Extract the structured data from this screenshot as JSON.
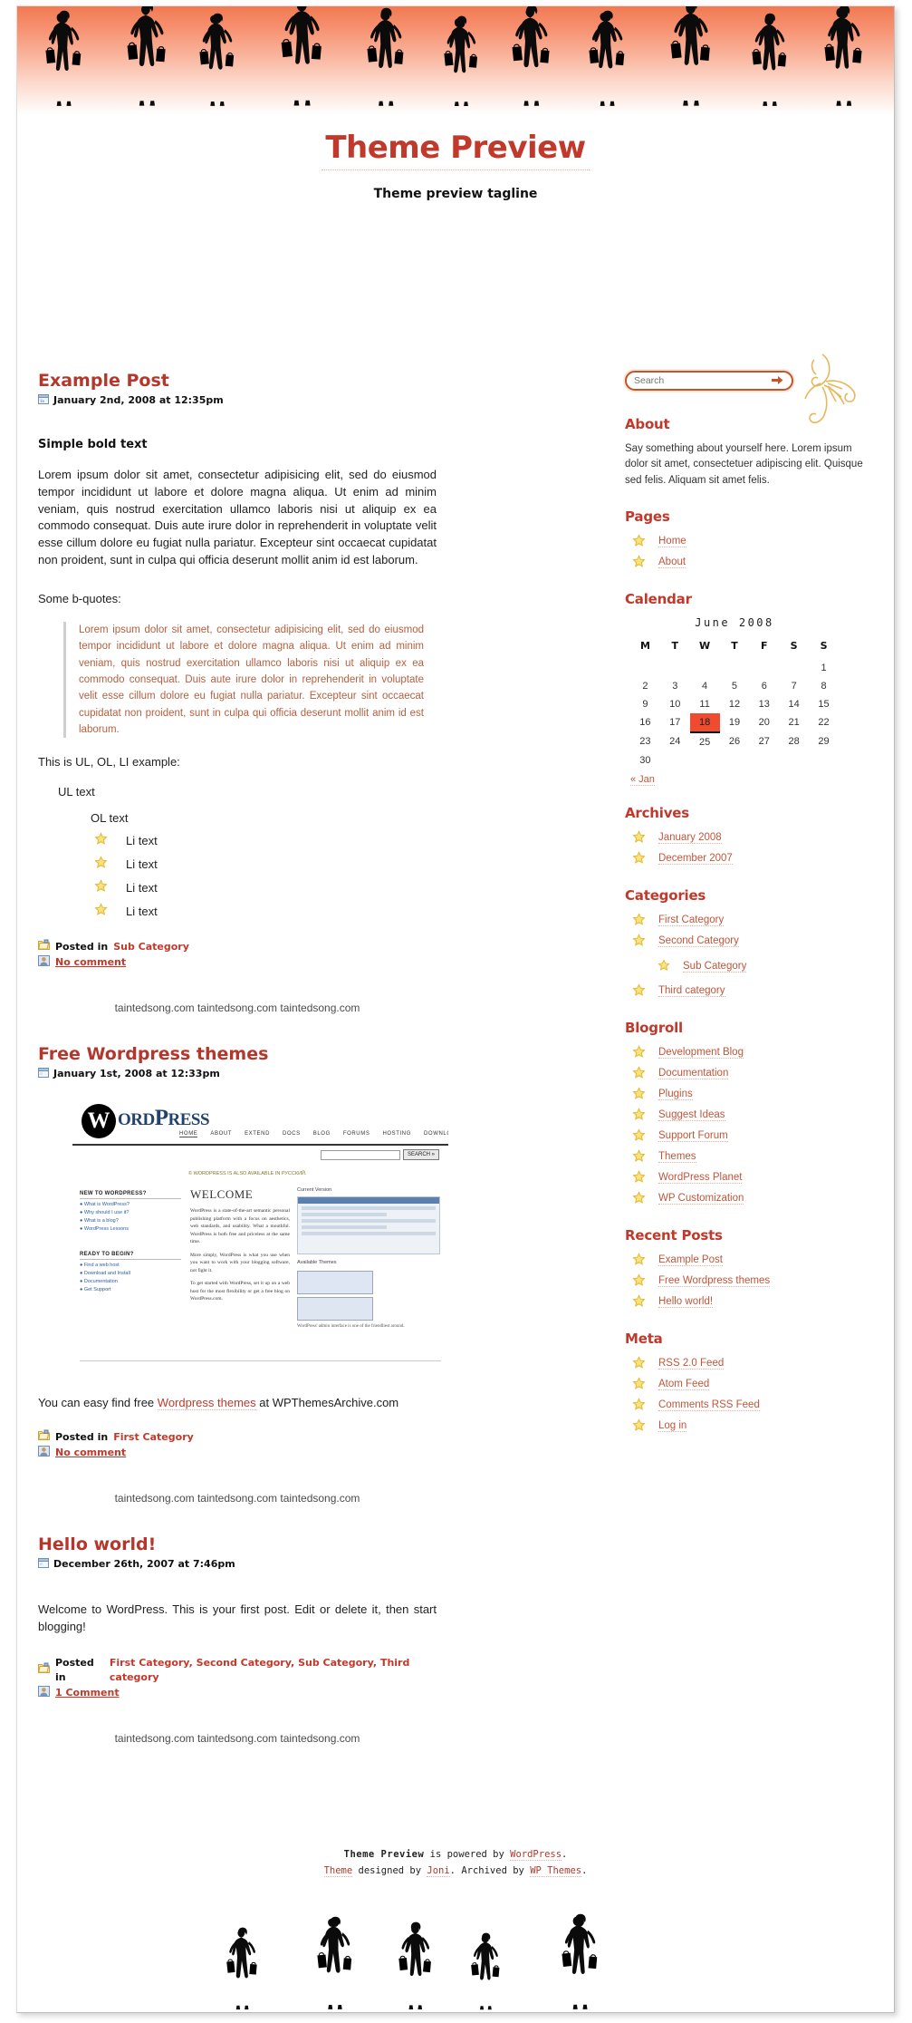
{
  "site": {
    "title": "Theme Preview",
    "tagline": "Theme preview tagline"
  },
  "colors": {
    "accent": "#c0392b",
    "link": "#c0563a",
    "quote": "#b5603f",
    "today_highlight": "#ef4b31",
    "header_gradient_top": "#f07a52"
  },
  "posts": [
    {
      "title": "Example Post",
      "date": "January 2nd, 2008 at 12:35pm",
      "date_icon": "calendar-icon",
      "bold_intro": "Simple bold text",
      "paragraph": "Lorem ipsum dolor sit amet, consectetur adipisicing elit, sed do eiusmod tempor incididunt ut labore et dolore magna aliqua. Ut enim ad minim veniam, quis nostrud exercitation ullamco laboris nisi ut aliquip ex ea commodo consequat. Duis aute irure dolor in reprehenderit in voluptate velit esse cillum dolore eu fugiat nulla pariatur. Excepteur sint occaecat cupidatat non proident, sunt in culpa qui officia deserunt mollit anim id est laborum.",
      "quote_label": "Some b-quotes:",
      "quote": "Lorem ipsum dolor sit amet, consectetur adipisicing elit, sed do eiusmod tempor incididunt ut labore et dolore magna aliqua. Ut enim ad minim veniam, quis nostrud exercitation ullamco laboris nisi ut aliquip ex ea commodo consequat. Duis aute irure dolor in reprehenderit in voluptate velit esse cillum dolore eu fugiat nulla pariatur. Excepteur sint occaecat cupidatat non proident, sunt in culpa qui officia deserunt mollit anim id est laborum.",
      "list_label": "This is UL, OL, LI example:",
      "ul_text": "UL text",
      "ol_text": "OL text",
      "li_items": [
        "Li text",
        "Li text",
        "Li text",
        "Li text"
      ],
      "posted_in_label": "Posted in",
      "categories": [
        "Sub Category"
      ],
      "comments": "No comment",
      "folder_icon": "folder-icon",
      "comment_icon": "comment-icon"
    },
    {
      "title": "Free Wordpress themes",
      "date": "January 1st, 2008 at 12:33pm",
      "date_icon": "calendar-icon",
      "caption_before": "You can easy find free ",
      "caption_link": "Wordpress themes",
      "caption_after": " at WPThemesArchive.com",
      "posted_in_label": "Posted in",
      "categories": [
        "First Category"
      ],
      "comments": "No comment",
      "folder_icon": "folder-icon",
      "comment_icon": "comment-icon"
    },
    {
      "title": "Hello world!",
      "date": "December 26th, 2007 at 7:46pm",
      "date_icon": "calendar-icon",
      "paragraph": "Welcome to WordPress. This is your first post. Edit or delete it, then start blogging!",
      "posted_in_label": "Posted in",
      "categories": [
        "First Category",
        "Second Category",
        "Sub Category",
        "Third category"
      ],
      "comments": "1 Comment",
      "folder_icon": "folder-icon",
      "comment_icon": "comment-icon"
    }
  ],
  "separator_text": "taintedsong.com taintedsong.com taintedsong.com",
  "screenshot": {
    "logo_w": "W",
    "logo_text_1": "ORD",
    "logo_text_2": "P",
    "logo_text_3": "RESS",
    "nav": [
      "HOME",
      "ABOUT",
      "EXTEND",
      "DOCS",
      "BLOG",
      "FORUMS",
      "HOSTING",
      "DOWNLOAD"
    ],
    "search_button": "SEARCH »",
    "also_available": "© WORDPRESS IS ALSO AVAILABLE IN РУССКИЙ.",
    "left_box_title": "NEW TO WORDPRESS?",
    "left_box_items": [
      "What is WordPress?",
      "Why should I use it?",
      "What is a blog?",
      "WordPress Lessons"
    ],
    "left_box2_title": "READY TO BEGIN?",
    "left_box2_items": [
      "Find a web host",
      "Download and Install",
      "Documentation",
      "Get Support"
    ],
    "welcome": "WELCOME",
    "para1": "WordPress is a state-of-the-art semantic personal publishing platform with a focus on aesthetics, web standards, and usability. What a mouthful. WordPress is both free and priceless at the same time.",
    "para2": "More simply, WordPress is what you use when you want to work with your blogging software, not fight it.",
    "para3": "To get started with WordPress, set it up on a web host for the most flexibility or get a free blog on WordPress.com.",
    "right_title": "Current Version",
    "right_caption": "WordPress' admin interface is one of the friendliest around.",
    "available_themes": "Available Themes"
  },
  "sidebar": {
    "search": {
      "placeholder": "Search",
      "value": "Search",
      "submit_icon": "arrow-right-icon"
    },
    "about": {
      "title": "About",
      "text": "Say something about yourself here. Lorem ipsum dolor sit amet, consectetuer adipiscing elit. Quisque sed felis. Aliquam sit amet felis."
    },
    "pages": {
      "title": "Pages",
      "items": [
        "Home",
        "About"
      ]
    },
    "calendar": {
      "title": "Calendar",
      "caption": "June 2008",
      "weekdays": [
        "M",
        "T",
        "W",
        "T",
        "F",
        "S",
        "S"
      ],
      "weeks": [
        [
          "",
          "",
          "",
          "",
          "",
          "",
          "1"
        ],
        [
          "2",
          "3",
          "4",
          "5",
          "6",
          "7",
          "8"
        ],
        [
          "9",
          "10",
          "11",
          "12",
          "13",
          "14",
          "15"
        ],
        [
          "16",
          "17",
          "18",
          "19",
          "20",
          "21",
          "22"
        ],
        [
          "23",
          "24",
          "25",
          "26",
          "27",
          "28",
          "29"
        ],
        [
          "30",
          "",
          "",
          "",
          "",
          "",
          ""
        ]
      ],
      "today": "18",
      "prev_link": "« Jan"
    },
    "archives": {
      "title": "Archives",
      "items": [
        "January 2008",
        "December 2007"
      ]
    },
    "categories": {
      "title": "Categories",
      "items": [
        {
          "label": "First Category",
          "sub": false
        },
        {
          "label": "Second Category",
          "sub": false
        },
        {
          "label": "Sub Category",
          "sub": true
        },
        {
          "label": "Third category",
          "sub": false
        }
      ]
    },
    "blogroll": {
      "title": "Blogroll",
      "items": [
        "Development Blog",
        "Documentation",
        "Plugins",
        "Suggest Ideas",
        "Support Forum",
        "Themes",
        "WordPress Planet",
        "WP Customization"
      ]
    },
    "recent_posts": {
      "title": "Recent Posts",
      "items": [
        "Example Post",
        "Free Wordpress themes",
        "Hello world!"
      ]
    },
    "meta": {
      "title": "Meta",
      "items": [
        "RSS 2.0 Feed",
        "Atom Feed",
        "Comments RSS Feed",
        "Log in"
      ]
    }
  },
  "footer": {
    "line1_title": "Theme Preview",
    "line1_mid": " is powered by ",
    "line1_link": "WordPress",
    "line1_end": ".",
    "line2_link1": "Theme",
    "line2_mid1": " designed by ",
    "line2_link2": "Joni",
    "line2_mid2": ". Archived by ",
    "line2_link3": "WP Themes",
    "line2_end": "."
  }
}
